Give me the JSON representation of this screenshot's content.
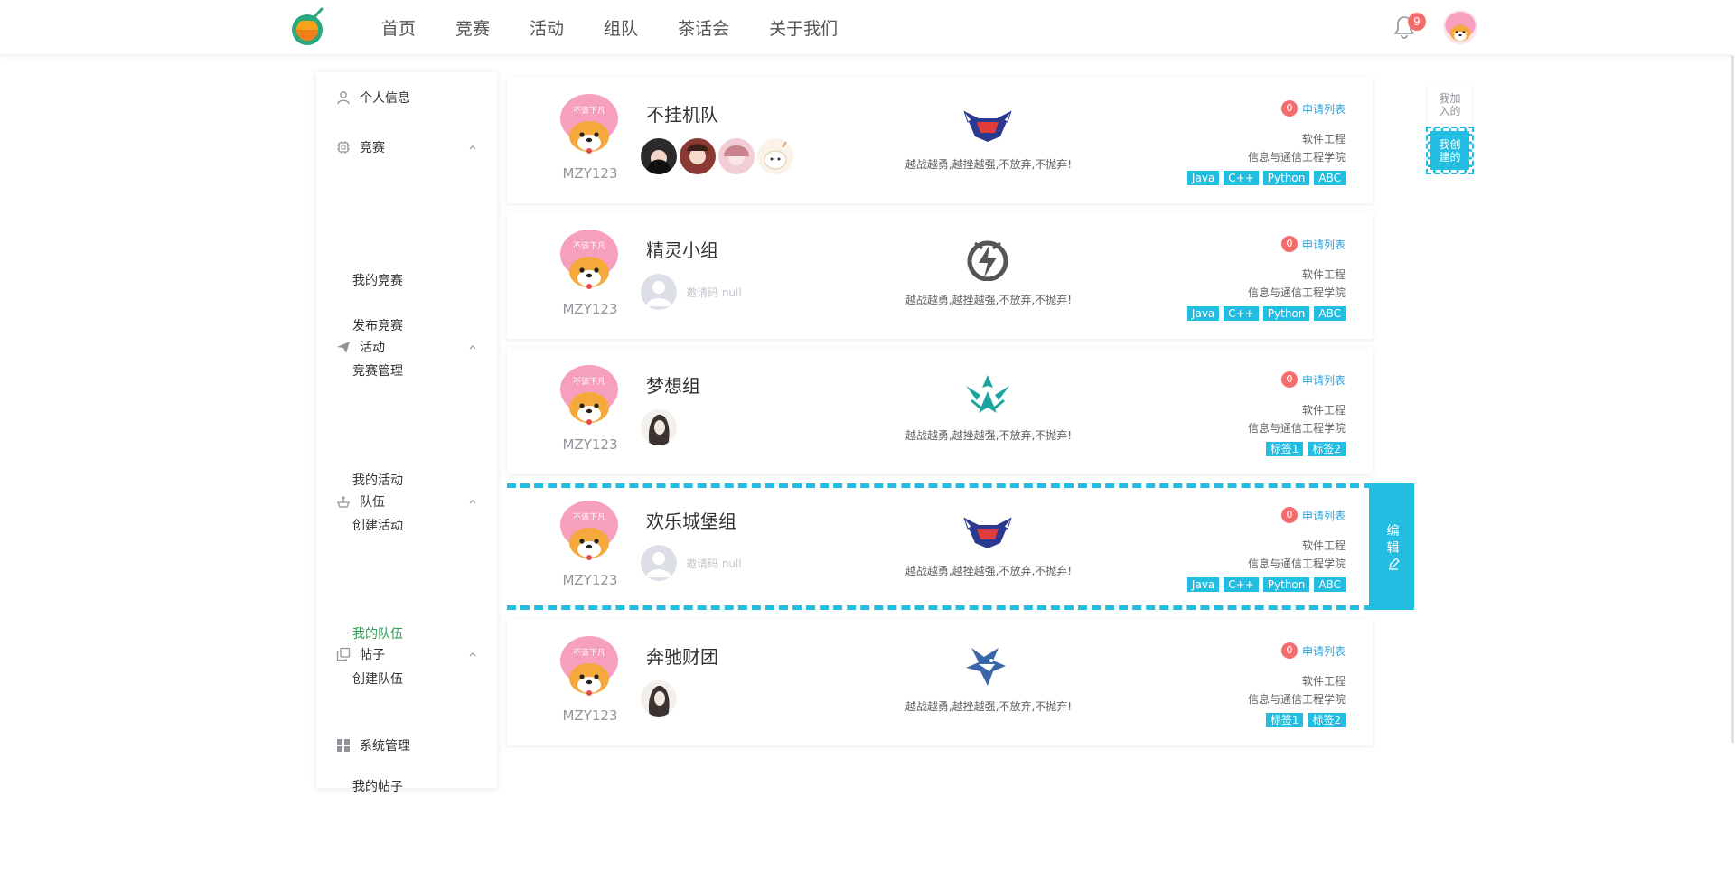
{
  "nav": {
    "items": [
      "首页",
      "竞赛",
      "活动",
      "组队",
      "茶话会",
      "关于我们"
    ]
  },
  "notifications": {
    "count": "9"
  },
  "sidebar": {
    "personal_info": "个人信息",
    "competition": {
      "label": "竞赛",
      "items": [
        "我的竞赛",
        "发布竞赛",
        "竞赛管理"
      ]
    },
    "activity": {
      "label": "活动",
      "items": [
        "我的活动",
        "创建活动"
      ]
    },
    "team": {
      "label": "队伍",
      "items": [
        "我的队伍",
        "创建队伍"
      ],
      "active_item": "我的队伍"
    },
    "posts": {
      "label": "帖子",
      "items": [
        "我的帖子"
      ]
    },
    "system": "系统管理"
  },
  "side_filter": {
    "joined": [
      "我加",
      "入的"
    ],
    "created": [
      "我创",
      "建的"
    ]
  },
  "teams": [
    {
      "name": "不挂机队",
      "leader": "MZY123",
      "avatar_text": "不该下凡",
      "slogan": "越战越勇,越挫越强,不放弃,不抛弃!",
      "apply_count": "0",
      "apply_label": "申请列表",
      "major": "软件工程",
      "college": "信息与通信工程学院",
      "tags": [
        "Java",
        "C++",
        "Python",
        "ABC"
      ],
      "invite": ""
    },
    {
      "name": "精灵小组",
      "leader": "MZY123",
      "avatar_text": "不该下凡",
      "slogan": "越战越勇,越挫越强,不放弃,不抛弃!",
      "apply_count": "0",
      "apply_label": "申请列表",
      "major": "软件工程",
      "college": "信息与通信工程学院",
      "tags": [
        "Java",
        "C++",
        "Python",
        "ABC"
      ],
      "invite": "邀请码 null"
    },
    {
      "name": "梦想组",
      "leader": "MZY123",
      "avatar_text": "不该下凡",
      "slogan": "越战越勇,越挫越强,不放弃,不抛弃!",
      "apply_count": "0",
      "apply_label": "申请列表",
      "major": "软件工程",
      "college": "信息与通信工程学院",
      "tags": [
        "标签1",
        "标签2"
      ],
      "invite": ""
    },
    {
      "name": "欢乐城堡组",
      "leader": "MZY123",
      "avatar_text": "不该下凡",
      "slogan": "越战越勇,越挫越强,不放弃,不抛弃!",
      "apply_count": "0",
      "apply_label": "申请列表",
      "major": "软件工程",
      "college": "信息与通信工程学院",
      "tags": [
        "Java",
        "C++",
        "Python",
        "ABC"
      ],
      "invite": "邀请码 null",
      "edit_label": [
        "编",
        "辑"
      ]
    },
    {
      "name": "奔驰财团",
      "leader": "MZY123",
      "avatar_text": "不该下凡",
      "slogan": "越战越勇,越挫越强,不放弃,不抛弃!",
      "apply_count": "0",
      "apply_label": "申请列表",
      "major": "软件工程",
      "college": "信息与通信工程学院",
      "tags": [
        "标签1",
        "标签2"
      ],
      "invite": ""
    }
  ],
  "colors": {
    "accent": "#22bde0",
    "badge": "#f56c6c",
    "active_menu": "#2e9a55",
    "link": "#2e9fd6"
  }
}
